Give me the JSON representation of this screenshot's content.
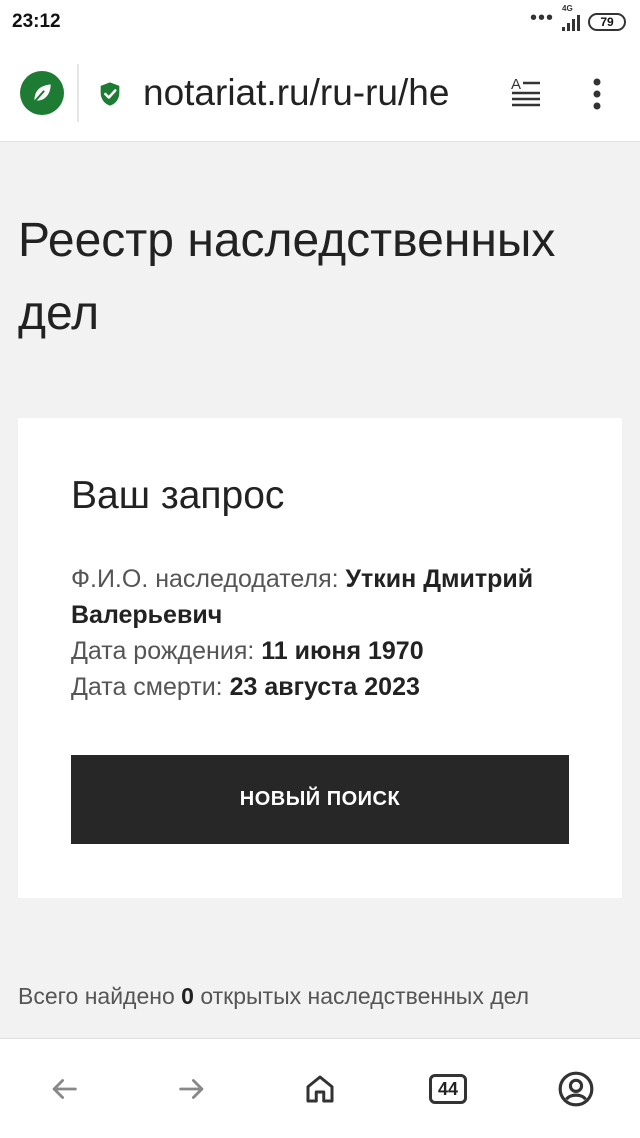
{
  "status_bar": {
    "time": "23:12",
    "network": "4G",
    "battery": "79"
  },
  "browser": {
    "url": "notariat.ru/ru-ru/he",
    "tabs_count": "44",
    "icons": {
      "site": "leaf-icon",
      "security": "shield-check-icon",
      "reader": "reader-mode-icon",
      "menu": "more-vert-icon",
      "back": "arrow-left-icon",
      "forward": "arrow-right-icon",
      "home": "home-icon",
      "tabs": "tabs-icon",
      "account": "account-icon"
    },
    "accent_color": "#1e7b33"
  },
  "page": {
    "title": "Реестр наследственных дел"
  },
  "request_card": {
    "title": "Ваш запрос",
    "fio_label": "Ф.И.О. наследодателя: ",
    "fio_value": "Уткин Дмитрий Валерьевич",
    "birth_label": "Дата рождения: ",
    "birth_value": "11 июня 1970",
    "death_label": "Дата смерти: ",
    "death_value": "23 августа 2023",
    "button_label": "НОВЫЙ ПОИСК"
  },
  "results": {
    "prefix": "Всего найдено ",
    "count": "0",
    "suffix": " открытых наследственных дел"
  }
}
